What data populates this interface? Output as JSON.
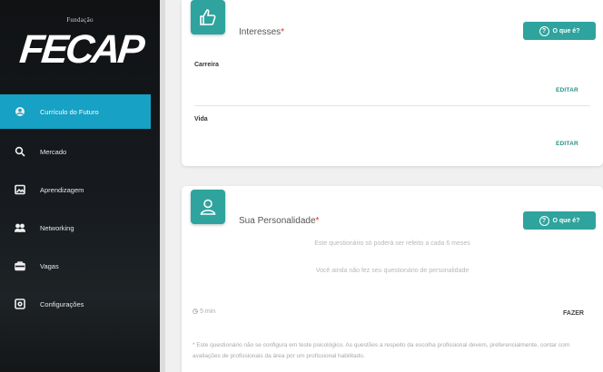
{
  "sidebar": {
    "brand_top": "Fundação",
    "brand": "FECAP",
    "items": [
      {
        "label": "Currículo do Futuro",
        "icon": "user-circle-icon",
        "active": true
      },
      {
        "label": "Mercado",
        "icon": "search-icon",
        "active": false
      },
      {
        "label": "Aprendizagem",
        "icon": "image-icon",
        "active": false
      },
      {
        "label": "Networking",
        "icon": "people-icon",
        "active": false
      },
      {
        "label": "Vagas",
        "icon": "briefcase-icon",
        "active": false
      },
      {
        "label": "Configurações",
        "icon": "settings-box-icon",
        "active": false
      }
    ]
  },
  "interests": {
    "title": "Interesses",
    "required_mark": "*",
    "what_button": "O que é?",
    "what_glyph": "?",
    "icon": "thumbs-up-icon",
    "fields": [
      {
        "label": "Carreira",
        "edit": "EDITAR"
      },
      {
        "label": "Vida",
        "edit": "EDITAR"
      }
    ]
  },
  "personality": {
    "title": "Sua Personalidade",
    "required_mark": "*",
    "what_button": "O que é?",
    "what_glyph": "?",
    "icon": "person-icon",
    "subtitle": "Este questionário só poderá ser refeito a cada 6 meses",
    "empty_message": "Você ainda não fez seu questionário de personalidade",
    "time_label": "5 min",
    "action": "FAZER",
    "footnote": "* Este questionário não se configura em teste psicológico. As questões a respeito da escolha profissional devem, preferencialmente, contar com avaliações de profissionais da área por um profissional habilitado."
  }
}
